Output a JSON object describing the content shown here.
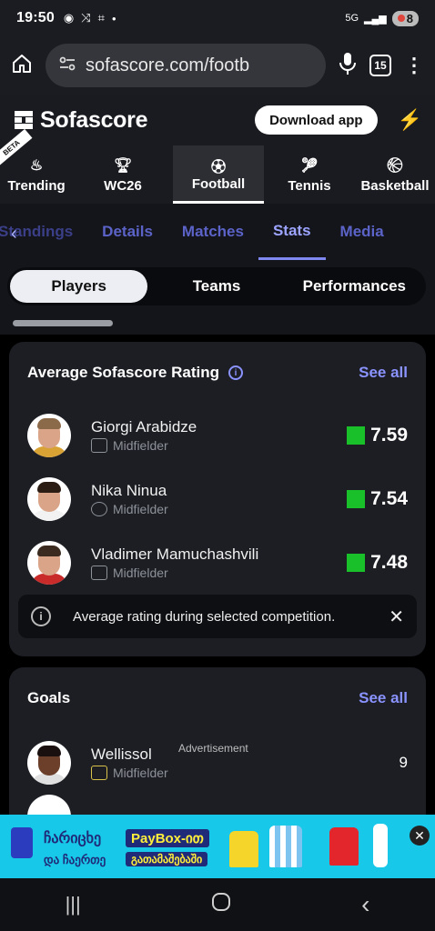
{
  "status": {
    "time": "19:50",
    "network": "5G",
    "battery": "8"
  },
  "browser": {
    "url": "sofascore.com/footb",
    "tab_count": "15"
  },
  "header": {
    "logo": "Sofascore",
    "download_label": "Download app"
  },
  "sport_tabs": [
    {
      "label": "Trending",
      "badge": "BETA"
    },
    {
      "label": "WC26"
    },
    {
      "label": "Football"
    },
    {
      "label": "Tennis"
    },
    {
      "label": "Basketball"
    }
  ],
  "sub_tabs": [
    "Standings",
    "Details",
    "Matches",
    "Stats",
    "Media"
  ],
  "segments": [
    "Players",
    "Teams",
    "Performances"
  ],
  "rating_card": {
    "title": "Average Sofascore Rating",
    "see_all": "See all",
    "players": [
      {
        "name": "Giorgi Arabidze",
        "position": "Midfielder",
        "rating": "7.59"
      },
      {
        "name": "Nika Ninua",
        "position": "Midfielder",
        "rating": "7.54"
      },
      {
        "name": "Vladimer Mamuchashvili",
        "position": "Midfielder",
        "rating": "7.48"
      }
    ],
    "note": "Average rating during selected competition."
  },
  "goals_card": {
    "title": "Goals",
    "see_all": "See all",
    "ad_label": "Advertisement",
    "players": [
      {
        "name": "Wellissol",
        "position": "Midfielder",
        "value": "9"
      }
    ]
  },
  "ad": {
    "line1": "ჩარიცხე",
    "pill1": "PayBox-ით",
    "line2": "და ჩაერთე",
    "pill2": "გათამაშებაში"
  },
  "colors": {
    "accent": "#8a93ff",
    "rating_green": "#19c02a",
    "card_bg": "#1c1e23"
  }
}
